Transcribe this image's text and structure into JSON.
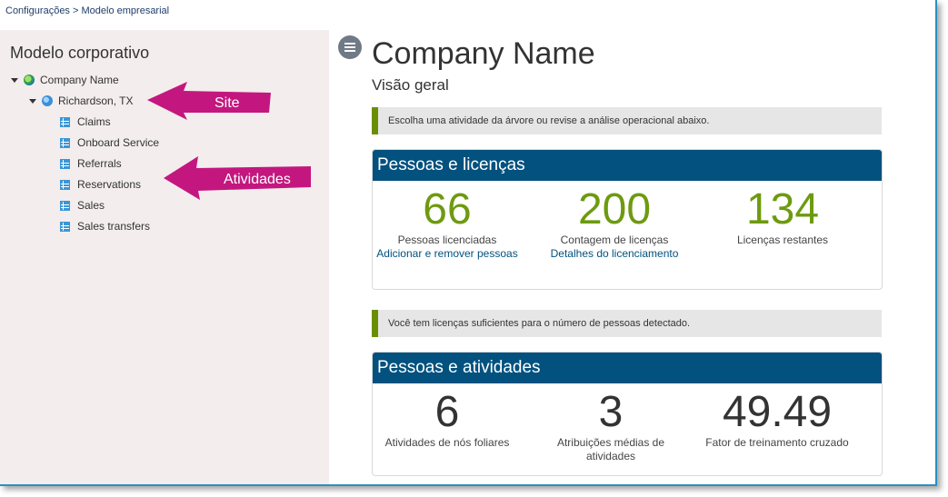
{
  "breadcrumb": {
    "root": "Configurações",
    "separator": ">",
    "current": "Modelo empresarial"
  },
  "sidebar": {
    "title": "Modelo corporativo",
    "tree": {
      "root": "Company Name",
      "site": "Richardson, TX",
      "activities": [
        "Claims",
        "Onboard Service",
        "Referrals",
        "Reservations",
        "Sales",
        "Sales transfers"
      ]
    },
    "annotations": {
      "site": "Site",
      "activities": "Atividades"
    }
  },
  "header": {
    "title": "Company Name",
    "subtitle": "Visão geral"
  },
  "info_messages": {
    "top": "Escolha uma atividade da árvore ou revise a análise operacional abaixo.",
    "middle": "Você tem licenças suficientes para o número de pessoas detectado."
  },
  "licenses_card": {
    "title": "Pessoas e licenças",
    "metrics": [
      {
        "value": "66",
        "label": "Pessoas licenciadas",
        "link": "Adicionar e remover pessoas"
      },
      {
        "value": "200",
        "label": "Contagem de licenças",
        "link": "Detalhes do licenciamento"
      },
      {
        "value": "134",
        "label": "Licenças restantes"
      }
    ]
  },
  "activities_card": {
    "title": "Pessoas e atividades",
    "metrics": [
      {
        "value": "6",
        "label": "Atividades de nós foliares"
      },
      {
        "value": "3",
        "label": "Atribuições médias de atividades"
      },
      {
        "value": "49.49",
        "label": "Fator de treinamento cruzado"
      }
    ]
  },
  "colors": {
    "header": "#02517e",
    "accent_green": "#6e9a10",
    "annotation_arrow": "#c3177f",
    "info_bar": "#6b8e00"
  }
}
